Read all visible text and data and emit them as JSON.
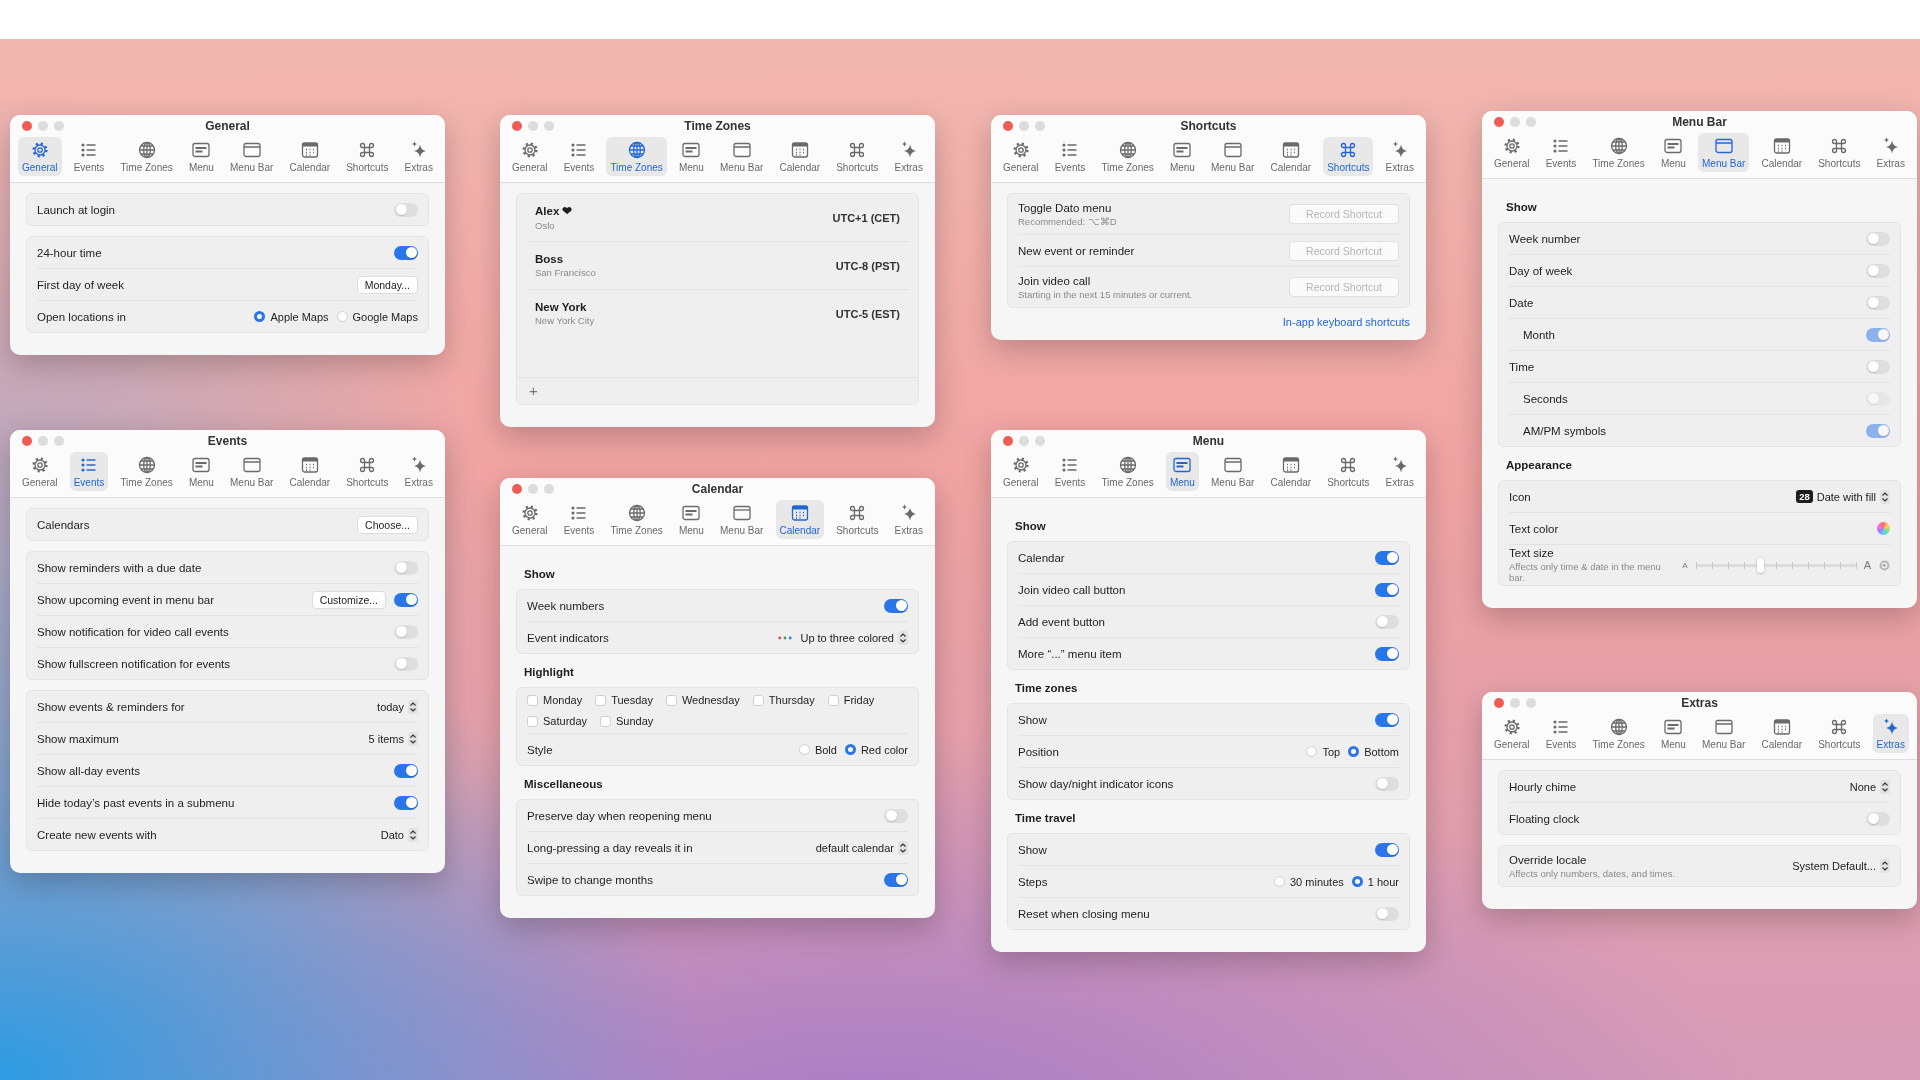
{
  "windows": [
    {
      "title": "General",
      "tabs": [
        {
          "label": "General",
          "selected": true
        },
        {
          "label": "Events",
          "selected": false
        },
        {
          "label": "Time Zones",
          "selected": false
        },
        {
          "label": "Menu",
          "selected": false
        },
        {
          "label": "Menu Bar",
          "selected": false
        },
        {
          "label": "Calendar",
          "selected": false
        },
        {
          "label": "Shortcuts",
          "selected": false
        },
        {
          "label": "Extras",
          "selected": false
        }
      ],
      "sections": [
        {
          "rows": [
            {
              "kind": "toggle",
              "label": "Launch at login",
              "on": false
            }
          ]
        },
        {
          "rows": [
            {
              "kind": "toggle",
              "label": "24-hour time",
              "on": true
            },
            {
              "kind": "button",
              "label": "First day of week",
              "button": "Monday..."
            },
            {
              "kind": "radio",
              "label": "Open locations in",
              "options": [
                {
                  "label": "Apple Maps",
                  "selected": true
                },
                {
                  "label": "Google Maps",
                  "selected": false
                }
              ]
            }
          ]
        }
      ]
    },
    {
      "title": "Time Zones",
      "tabs": [
        {
          "label": "General",
          "selected": false
        },
        {
          "label": "Events",
          "selected": false
        },
        {
          "label": "Time Zones",
          "selected": true
        },
        {
          "label": "Menu",
          "selected": false
        },
        {
          "label": "Menu Bar",
          "selected": false
        },
        {
          "label": "Calendar",
          "selected": false
        },
        {
          "label": "Shortcuts",
          "selected": false
        },
        {
          "label": "Extras",
          "selected": false
        }
      ],
      "sections": [
        {
          "rows": [
            {
              "kind": "zone",
              "name": "Alex ❤",
              "city": "Oslo",
              "offset": "UTC+1 (CET)"
            },
            {
              "kind": "zone",
              "name": "Boss",
              "city": "San Francisco",
              "offset": "UTC-8 (PST)"
            },
            {
              "kind": "zone",
              "name": "New York",
              "city": "New York City",
              "offset": "UTC-5 (EST)"
            }
          ],
          "add": "+"
        }
      ]
    },
    {
      "title": "Shortcuts",
      "tabs": [
        {
          "label": "General",
          "selected": false
        },
        {
          "label": "Events",
          "selected": false
        },
        {
          "label": "Time Zones",
          "selected": false
        },
        {
          "label": "Menu",
          "selected": false
        },
        {
          "label": "Menu Bar",
          "selected": false
        },
        {
          "label": "Calendar",
          "selected": false
        },
        {
          "label": "Shortcuts",
          "selected": true
        },
        {
          "label": "Extras",
          "selected": false
        }
      ],
      "sections": [
        {
          "rows": [
            {
              "kind": "record",
              "label": "Toggle Dato menu",
              "sublabel": "Recommended: ⌥⌘D",
              "button": "Record Shortcut"
            },
            {
              "kind": "record",
              "label": "New event or reminder",
              "button": "Record Shortcut"
            },
            {
              "kind": "record",
              "label": "Join video call",
              "sublabel": "Starting in the next 15 minutes or current.",
              "button": "Record Shortcut"
            }
          ]
        }
      ],
      "link": "In-app keyboard shortcuts"
    },
    {
      "title": "Menu Bar",
      "tabs": [
        {
          "label": "General",
          "selected": false
        },
        {
          "label": "Events",
          "selected": false
        },
        {
          "label": "Time Zones",
          "selected": false
        },
        {
          "label": "Menu",
          "selected": false
        },
        {
          "label": "Menu Bar",
          "selected": true
        },
        {
          "label": "Calendar",
          "selected": false
        },
        {
          "label": "Shortcuts",
          "selected": false
        },
        {
          "label": "Extras",
          "selected": false
        }
      ],
      "sections": [
        {
          "heading": "Show",
          "rows": [
            {
              "kind": "toggle",
              "label": "Week number",
              "on": false,
              "disabled": false
            },
            {
              "kind": "toggle",
              "label": "Day of week",
              "on": false,
              "disabled": false
            },
            {
              "kind": "toggle",
              "label": "Date",
              "on": false,
              "disabled": false,
              "children": [
                {
                  "kind": "toggle",
                  "label": "Month",
                  "on": true,
                  "disabled": true
                }
              ]
            },
            {
              "kind": "toggle",
              "label": "Time",
              "on": false,
              "disabled": false,
              "children": [
                {
                  "kind": "toggle",
                  "label": "Seconds",
                  "on": false,
                  "disabled": true
                },
                {
                  "kind": "toggle",
                  "label": "AM/PM symbols",
                  "on": true,
                  "disabled": true
                }
              ]
            }
          ]
        },
        {
          "heading": "Appearance",
          "rows": [
            {
              "kind": "popup",
              "label": "Icon",
              "badge": "28",
              "value": "Date with fill"
            },
            {
              "kind": "color",
              "label": "Text color"
            },
            {
              "kind": "slider",
              "label": "Text size",
              "sublabel": "Affects only time & date in the menu bar.",
              "level": 0.4,
              "min_label": "A",
              "max_label": "A"
            }
          ]
        }
      ]
    },
    {
      "title": "Events",
      "tabs": [
        {
          "label": "General",
          "selected": false
        },
        {
          "label": "Events",
          "selected": true
        },
        {
          "label": "Time Zones",
          "selected": false
        },
        {
          "label": "Menu",
          "selected": false
        },
        {
          "label": "Menu Bar",
          "selected": false
        },
        {
          "label": "Calendar",
          "selected": false
        },
        {
          "label": "Shortcuts",
          "selected": false
        },
        {
          "label": "Extras",
          "selected": false
        }
      ],
      "sections": [
        {
          "rows": [
            {
              "kind": "button",
              "label": "Calendars",
              "button": "Choose..."
            }
          ]
        },
        {
          "rows": [
            {
              "kind": "toggle",
              "label": "Show reminders with a due date",
              "on": false
            },
            {
              "kind": "toggle",
              "label": "Show upcoming event in menu bar",
              "on": true,
              "button": "Customize..."
            },
            {
              "kind": "toggle",
              "label": "Show notification for video call events",
              "on": false
            },
            {
              "kind": "toggle",
              "label": "Show fullscreen notification for events",
              "on": false
            }
          ]
        },
        {
          "rows": [
            {
              "kind": "popup",
              "label": "Show events & reminders for",
              "value": "today"
            },
            {
              "kind": "popup",
              "label": "Show maximum",
              "value": "5 items"
            },
            {
              "kind": "toggle",
              "label": "Show all-day events",
              "on": true
            },
            {
              "kind": "toggle",
              "label": "Hide today’s past events in a submenu",
              "on": true
            },
            {
              "kind": "popup",
              "label": "Create new events with",
              "value": "Dato"
            }
          ]
        }
      ]
    },
    {
      "title": "Calendar",
      "tabs": [
        {
          "label": "General",
          "selected": false
        },
        {
          "label": "Events",
          "selected": false
        },
        {
          "label": "Time Zones",
          "selected": false
        },
        {
          "label": "Menu",
          "selected": false
        },
        {
          "label": "Menu Bar",
          "selected": false
        },
        {
          "label": "Calendar",
          "selected": true
        },
        {
          "label": "Shortcuts",
          "selected": false
        },
        {
          "label": "Extras",
          "selected": false
        }
      ],
      "sections": [
        {
          "heading": "Show",
          "rows": [
            {
              "kind": "toggle",
              "label": "Week numbers",
              "on": true
            },
            {
              "kind": "popup",
              "label": "Event indicators",
              "dots": true,
              "value": "Up to three colored"
            }
          ]
        },
        {
          "heading": "Highlight",
          "rows": [
            {
              "kind": "checks",
              "options": [
                {
                  "label": "Monday",
                  "checked": false
                },
                {
                  "label": "Tuesday",
                  "checked": false
                },
                {
                  "label": "Wednesday",
                  "checked": false
                },
                {
                  "label": "Thursday",
                  "checked": false
                },
                {
                  "label": "Friday",
                  "checked": false
                },
                {
                  "label": "Saturday",
                  "checked": false
                },
                {
                  "label": "Sunday",
                  "checked": false
                }
              ]
            },
            {
              "kind": "radio",
              "label": "Style",
              "options": [
                {
                  "label": "Bold",
                  "selected": false
                },
                {
                  "label": "Red color",
                  "selected": true
                }
              ]
            }
          ]
        },
        {
          "heading": "Miscellaneous",
          "rows": [
            {
              "kind": "toggle",
              "label": "Preserve day when reopening menu",
              "on": false
            },
            {
              "kind": "popup",
              "label": "Long-pressing a day reveals it in",
              "value": "default calendar"
            },
            {
              "kind": "toggle",
              "label": "Swipe to change months",
              "on": true
            }
          ]
        }
      ]
    },
    {
      "title": "Menu",
      "tabs": [
        {
          "label": "General",
          "selected": false
        },
        {
          "label": "Events",
          "selected": false
        },
        {
          "label": "Time Zones",
          "selected": false
        },
        {
          "label": "Menu",
          "selected": true
        },
        {
          "label": "Menu Bar",
          "selected": false
        },
        {
          "label": "Calendar",
          "selected": false
        },
        {
          "label": "Shortcuts",
          "selected": false
        },
        {
          "label": "Extras",
          "selected": false
        }
      ],
      "sections": [
        {
          "heading": "Show",
          "rows": [
            {
              "kind": "toggle",
              "label": "Calendar",
              "on": true
            },
            {
              "kind": "toggle",
              "label": "Join video call button",
              "on": true
            },
            {
              "kind": "toggle",
              "label": "Add event button",
              "on": false
            },
            {
              "kind": "toggle",
              "label": "More “...” menu item",
              "on": true
            }
          ]
        },
        {
          "heading": "Time zones",
          "rows": [
            {
              "kind": "toggle",
              "label": "Show",
              "on": true
            },
            {
              "kind": "radio",
              "label": "Position",
              "options": [
                {
                  "label": "Top",
                  "selected": false
                },
                {
                  "label": "Bottom",
                  "selected": true
                }
              ]
            },
            {
              "kind": "toggle",
              "label": "Show day/night indicator icons",
              "on": false
            }
          ]
        },
        {
          "heading": "Time travel",
          "rows": [
            {
              "kind": "toggle",
              "label": "Show",
              "on": true
            },
            {
              "kind": "radio",
              "label": "Steps",
              "options": [
                {
                  "label": "30 minutes",
                  "selected": false
                },
                {
                  "label": "1 hour",
                  "selected": true
                }
              ]
            },
            {
              "kind": "toggle",
              "label": "Reset when closing menu",
              "on": false
            }
          ]
        }
      ]
    },
    {
      "title": "Extras",
      "tabs": [
        {
          "label": "General",
          "selected": false
        },
        {
          "label": "Events",
          "selected": false
        },
        {
          "label": "Time Zones",
          "selected": false
        },
        {
          "label": "Menu",
          "selected": false
        },
        {
          "label": "Menu Bar",
          "selected": false
        },
        {
          "label": "Calendar",
          "selected": false
        },
        {
          "label": "Shortcuts",
          "selected": false
        },
        {
          "label": "Extras",
          "selected": true
        }
      ],
      "sections": [
        {
          "rows": [
            {
              "kind": "popup",
              "label": "Hourly chime",
              "value": "None"
            },
            {
              "kind": "toggle",
              "label": "Floating clock",
              "on": false
            }
          ]
        },
        {
          "rows": [
            {
              "kind": "popup",
              "label": "Override locale",
              "sublabel": "Affects only numbers, dates, and times.",
              "value": "System Default..."
            }
          ]
        }
      ]
    }
  ]
}
